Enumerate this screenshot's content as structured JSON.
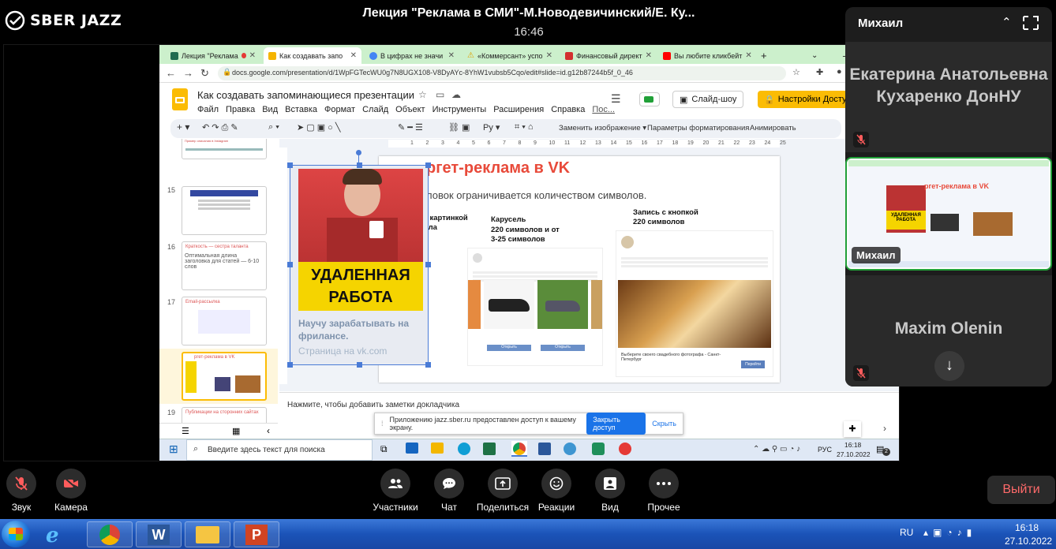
{
  "app": {
    "logo_text": "SBER JAZZ",
    "meeting_title": "Лекция \"Реклама в СМИ\"-М.Новодевичинский/Е. Ку...",
    "meeting_time": "16:46"
  },
  "browser": {
    "tabs": [
      {
        "label": "Лекция \"Реклама",
        "color": "#3b8f3b"
      },
      {
        "label": "Как создавать запо",
        "color": "#f5b400",
        "active": true
      },
      {
        "label": "В цифрах не значи",
        "color": "#4285f4"
      },
      {
        "label": "«Коммерсант» успо",
        "color": "#e0a000"
      },
      {
        "label": "Финансовый директ",
        "color": "#d32f2f"
      },
      {
        "label": "Вы любите кликбейт",
        "color": "#ff0000"
      }
    ],
    "new_tab": "+",
    "url": "docs.google.com/presentation/d/1WpFGTecWU0g7N8UGX108-V8DyAYc-8YhW1vubsb5Cqo/edit#slide=id.g12b87244b5f_0_46"
  },
  "slides_app": {
    "doc_title": "Как создавать запоминающиеся презентации",
    "menu": [
      "Файл",
      "Правка",
      "Вид",
      "Вставка",
      "Формат",
      "Слайд",
      "Объект",
      "Инструменты",
      "Расширения",
      "Справка",
      "Пос..."
    ],
    "slideshow_label": "Слайд-шоу",
    "access_label": "Настройки Доступ",
    "toolbar_text": {
      "replace_image": "Заменить изображение",
      "format_options": "Параметры форматирования",
      "animate": "Анимировать"
    },
    "ruler_ticks": [
      "1",
      "2",
      "3",
      "4",
      "5",
      "6",
      "7",
      "8",
      "9",
      "10",
      "11",
      "12",
      "13",
      "14",
      "15",
      "16",
      "17",
      "18",
      "19",
      "20",
      "21",
      "22",
      "23",
      "24",
      "25"
    ],
    "thumbs": [
      {
        "num": "",
        "text": "Пример описания в Instagram"
      },
      {
        "num": "15",
        "text": ""
      },
      {
        "num": "16",
        "title": "Краткость — сестра таланта",
        "text": "Оптимальная длина заголовка для статей — 6-10 слов"
      },
      {
        "num": "17",
        "title": "Email-рассылка",
        "text": ""
      },
      {
        "num": "18",
        "title": "ргет-реклама в VK",
        "text": ""
      },
      {
        "num": "19",
        "title": "Публикации на сторонних сайтах",
        "text": ""
      }
    ],
    "notes_placeholder": "Нажмите, чтобы добавить заметки докладчика",
    "slide": {
      "title": "ргет-реклама в VK",
      "subtitle": "ловок ограничивается количеством символов.",
      "card_big_text": "УДАЛЕННАЯ РАБОТА",
      "card_caption": "Научу зарабатывать на фрилансе.",
      "card_footer": "Страница на vk.com",
      "col1_title": "Запись с картинкой",
      "col1_sub": "33 символа",
      "col2_title": "Карусель",
      "col2_sub1": "220 символов и от",
      "col2_sub2": "3-25 символов",
      "col3_title": "Запись с кнопкой",
      "col3_sub": "220 символов",
      "col3_caption": "Выберите своего свадебного фотографа - Санкт-Петербург",
      "col3_button": "Перейти",
      "col2_button": "Открыть"
    }
  },
  "share_banner": {
    "text": "Приложению jazz.sber.ru предоставлен доступ к вашему экрану.",
    "stop": "Закрыть доступ",
    "hide": "Скрыть"
  },
  "win_taskbar": {
    "search_placeholder": "Введите здесь текст для поиска",
    "lang": "РУС",
    "time": "16:18",
    "date": "27.10.2022",
    "notif": "2"
  },
  "sidebar": {
    "header_name": "Михаил",
    "tiles": [
      {
        "name": "Екатерина Анатольевна Кухаренко ДонНУ"
      },
      {
        "name": "Михаил"
      },
      {
        "name": "Maxim Olenin"
      }
    ]
  },
  "controls": [
    {
      "label": "Звук"
    },
    {
      "label": "Камера"
    },
    {
      "label": "Участники"
    },
    {
      "label": "Чат"
    },
    {
      "label": "Поделиться"
    },
    {
      "label": "Реакции"
    },
    {
      "label": "Вид"
    },
    {
      "label": "Прочее"
    }
  ],
  "exit_label": "Выйти",
  "xp_taskbar": {
    "lang": "RU",
    "time": "16:18",
    "date": "27.10.2022"
  },
  "colors": {
    "accent_green": "#21a038",
    "mute_red": "#ff5c5c",
    "slides_yellow": "#fbbc04",
    "share_blue": "#1a73e8"
  }
}
